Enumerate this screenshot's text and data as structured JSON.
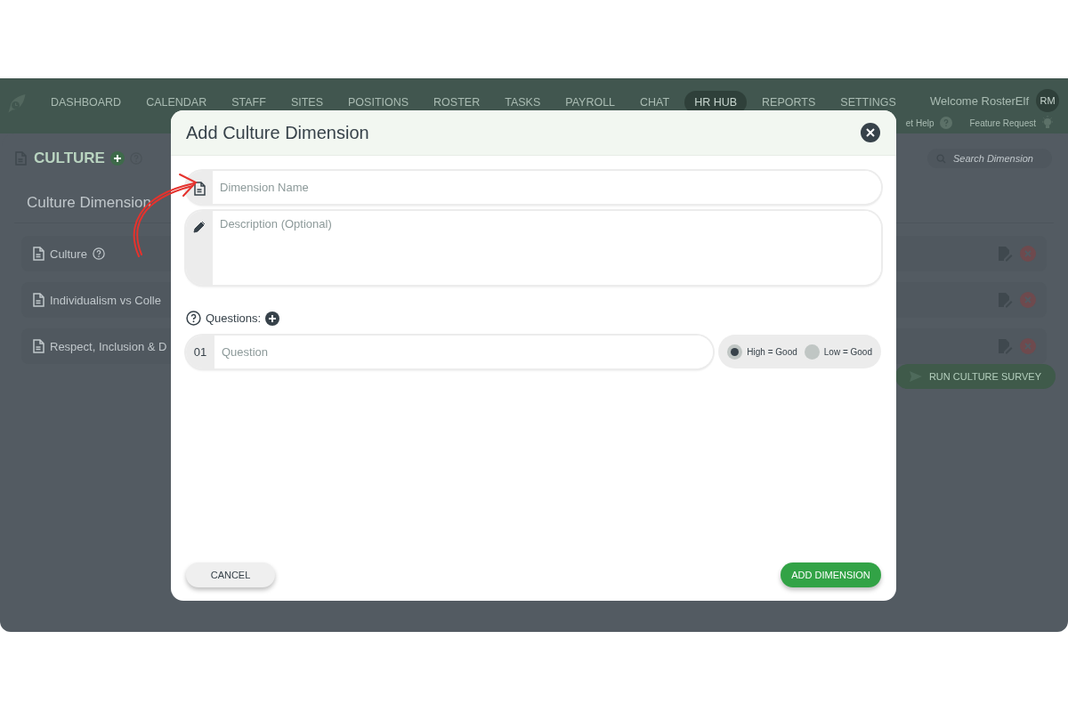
{
  "nav": {
    "items": [
      {
        "label": "DASHBOARD",
        "selected": false
      },
      {
        "label": "CALENDAR",
        "selected": false
      },
      {
        "label": "STAFF",
        "selected": false
      },
      {
        "label": "SITES",
        "selected": false
      },
      {
        "label": "POSITIONS",
        "selected": false
      },
      {
        "label": "ROSTER",
        "selected": false
      },
      {
        "label": "TASKS",
        "selected": false
      },
      {
        "label": "PAYROLL",
        "selected": false
      },
      {
        "label": "CHAT",
        "selected": false
      },
      {
        "label": "HR HUB",
        "selected": true
      },
      {
        "label": "REPORTS",
        "selected": false
      },
      {
        "label": "SETTINGS",
        "selected": false
      }
    ],
    "welcome": "Welcome RosterElf",
    "avatar": "RM",
    "help": "et Help",
    "feature_request": "Feature Request"
  },
  "page": {
    "title": "CULTURE",
    "search": {
      "placeholder": "Search Dimension"
    },
    "section_title": "Culture Dimension",
    "rows": [
      {
        "label": "Culture",
        "help": true
      },
      {
        "label": "Individualism vs Colle",
        "help": false
      },
      {
        "label": "Respect, Inclusion & D",
        "help": false
      }
    ],
    "survey_button": "RUN CULTURE SURVEY"
  },
  "modal": {
    "title": "Add Culture Dimension",
    "name_field": {
      "placeholder": "Dimension Name"
    },
    "description_field": {
      "placeholder": "Description (Optional)"
    },
    "questions_label": "Questions:",
    "questions": [
      {
        "number": "01",
        "placeholder": "Question",
        "options": [
          {
            "label": "High = Good",
            "selected": true
          },
          {
            "label": "Low = Good",
            "selected": false
          }
        ]
      }
    ],
    "cancel": "CANCEL",
    "submit": "ADD DIMENSION"
  }
}
